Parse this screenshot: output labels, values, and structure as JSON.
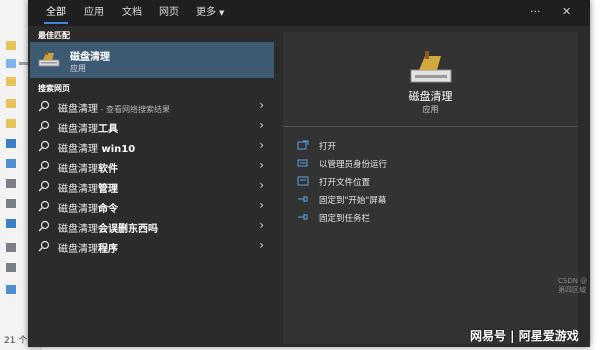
{
  "explorer": {
    "status_count": "21 个"
  },
  "search": {
    "tabs": [
      {
        "label": "全部"
      },
      {
        "label": "应用"
      },
      {
        "label": "文档"
      },
      {
        "label": "网页"
      },
      {
        "label": "更多"
      }
    ],
    "more_button": "···",
    "close_button": "✕",
    "best_match": {
      "section_label": "最佳匹配",
      "title": "磁盘清理",
      "subtitle": "应用"
    },
    "web_section_label": "搜索网页",
    "web_results": [
      {
        "prefix": "磁盘清理",
        "suffix": "",
        "hint": " - 查看网络搜索结果"
      },
      {
        "prefix": "磁盘清理",
        "suffix": "工具",
        "hint": ""
      },
      {
        "prefix": "磁盘清理",
        "suffix": " win10",
        "hint": ""
      },
      {
        "prefix": "磁盘清理",
        "suffix": "软件",
        "hint": ""
      },
      {
        "prefix": "磁盘清理",
        "suffix": "管理",
        "hint": ""
      },
      {
        "prefix": "磁盘清理",
        "suffix": "命令",
        "hint": ""
      },
      {
        "prefix": "磁盘清理",
        "suffix": "会误删东西吗",
        "hint": ""
      },
      {
        "prefix": "磁盘清理",
        "suffix": "程序",
        "hint": ""
      }
    ],
    "preview": {
      "app_name": "磁盘清理",
      "app_type": "应用",
      "actions": [
        {
          "label": "打开"
        },
        {
          "label": "以管理员身份运行"
        },
        {
          "label": "打开文件位置"
        },
        {
          "label": "固定到\"开始\"屏幕"
        },
        {
          "label": "固定到任务栏"
        }
      ]
    }
  },
  "watermark": {
    "small": "CSDN @第四区域",
    "main": "网易号 | 阿星爱游戏"
  }
}
